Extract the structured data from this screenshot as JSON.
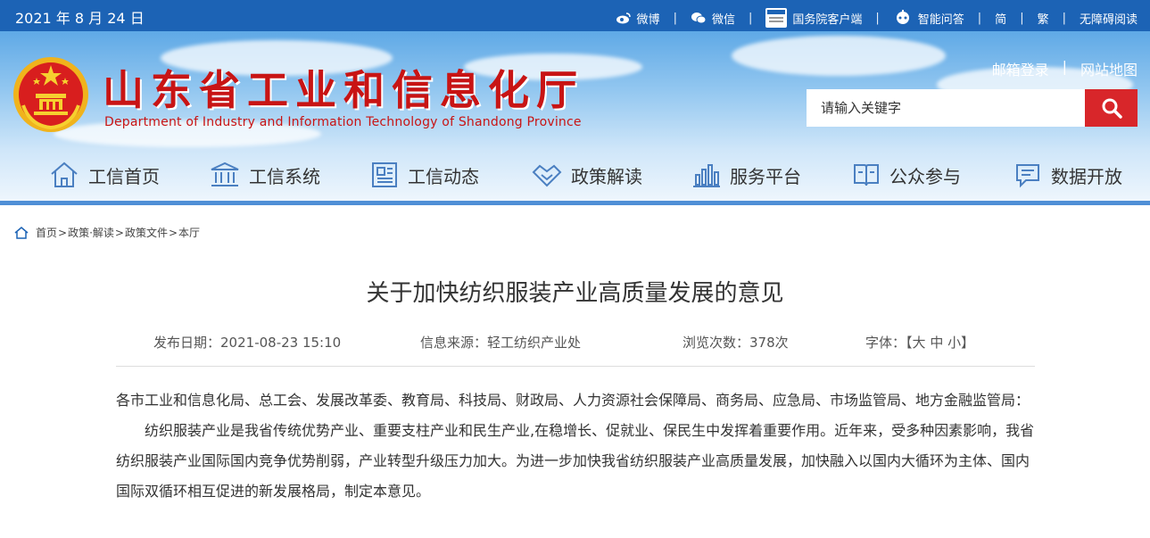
{
  "topbar": {
    "date": "2021 年 8 月 24 日",
    "links": {
      "weibo": "微博",
      "wechat": "微信",
      "client": "国务院客户端",
      "qa": "智能问答",
      "simplified": "简",
      "traditional": "繁",
      "accessibility": "无障碍阅读"
    },
    "separator": "|"
  },
  "header": {
    "title": "山东省工业和信息化厅",
    "subtitle": "Department of Industry and Information Technology of Shandong Province",
    "mail_login": "邮箱登录",
    "sitemap": "网站地图",
    "separator": "|"
  },
  "search": {
    "placeholder": "请输入关键字",
    "button_icon": "search-icon"
  },
  "nav": {
    "items": [
      {
        "label": "工信首页",
        "icon": "home-icon"
      },
      {
        "label": "工信系统",
        "icon": "institution-icon"
      },
      {
        "label": "工信动态",
        "icon": "news-icon"
      },
      {
        "label": "政策解读",
        "icon": "handshake-icon"
      },
      {
        "label": "服务平台",
        "icon": "bar-chart-icon"
      },
      {
        "label": "公众参与",
        "icon": "book-icon"
      },
      {
        "label": "数据开放",
        "icon": "message-icon"
      }
    ]
  },
  "breadcrumb": {
    "items": [
      "首页",
      "政策·解读",
      "政策文件",
      "本厅"
    ],
    "separator": ">"
  },
  "article": {
    "title": "关于加快纺织服装产业高质量发展的意见",
    "meta": {
      "date_label": "发布日期：",
      "date": "2021-08-23 15:10",
      "source_label": "信息来源：",
      "source": "轻工纺织产业处",
      "views_label": "浏览次数：",
      "views": "378次",
      "font_label": "字体：",
      "bracket_open": "【",
      "size_large": "大",
      "size_medium": "中",
      "size_small": "小",
      "bracket_close": "】"
    },
    "paragraphs": [
      "各市工业和信息化局、总工会、发展改革委、教育局、科技局、财政局、人力资源社会保障局、商务局、应急局、市场监管局、地方金融监管局：",
      "纺织服装产业是我省传统优势产业、重要支柱产业和民生产业,在稳增长、促就业、保民生中发挥着重要作用。近年来，受多种因素影响，我省纺织服装产业国际国内竞争优势削弱，产业转型升级压力加大。为进一步加快我省纺织服装产业高质量发展，加快融入以国内大循环为主体、国内国际双循环相互促进的新发展格局，制定本意见。"
    ]
  },
  "colors": {
    "topbar": "#1c63b5",
    "title_red": "#c81414",
    "search_button": "#d8262a",
    "nav_line": "#4f8fd6"
  }
}
